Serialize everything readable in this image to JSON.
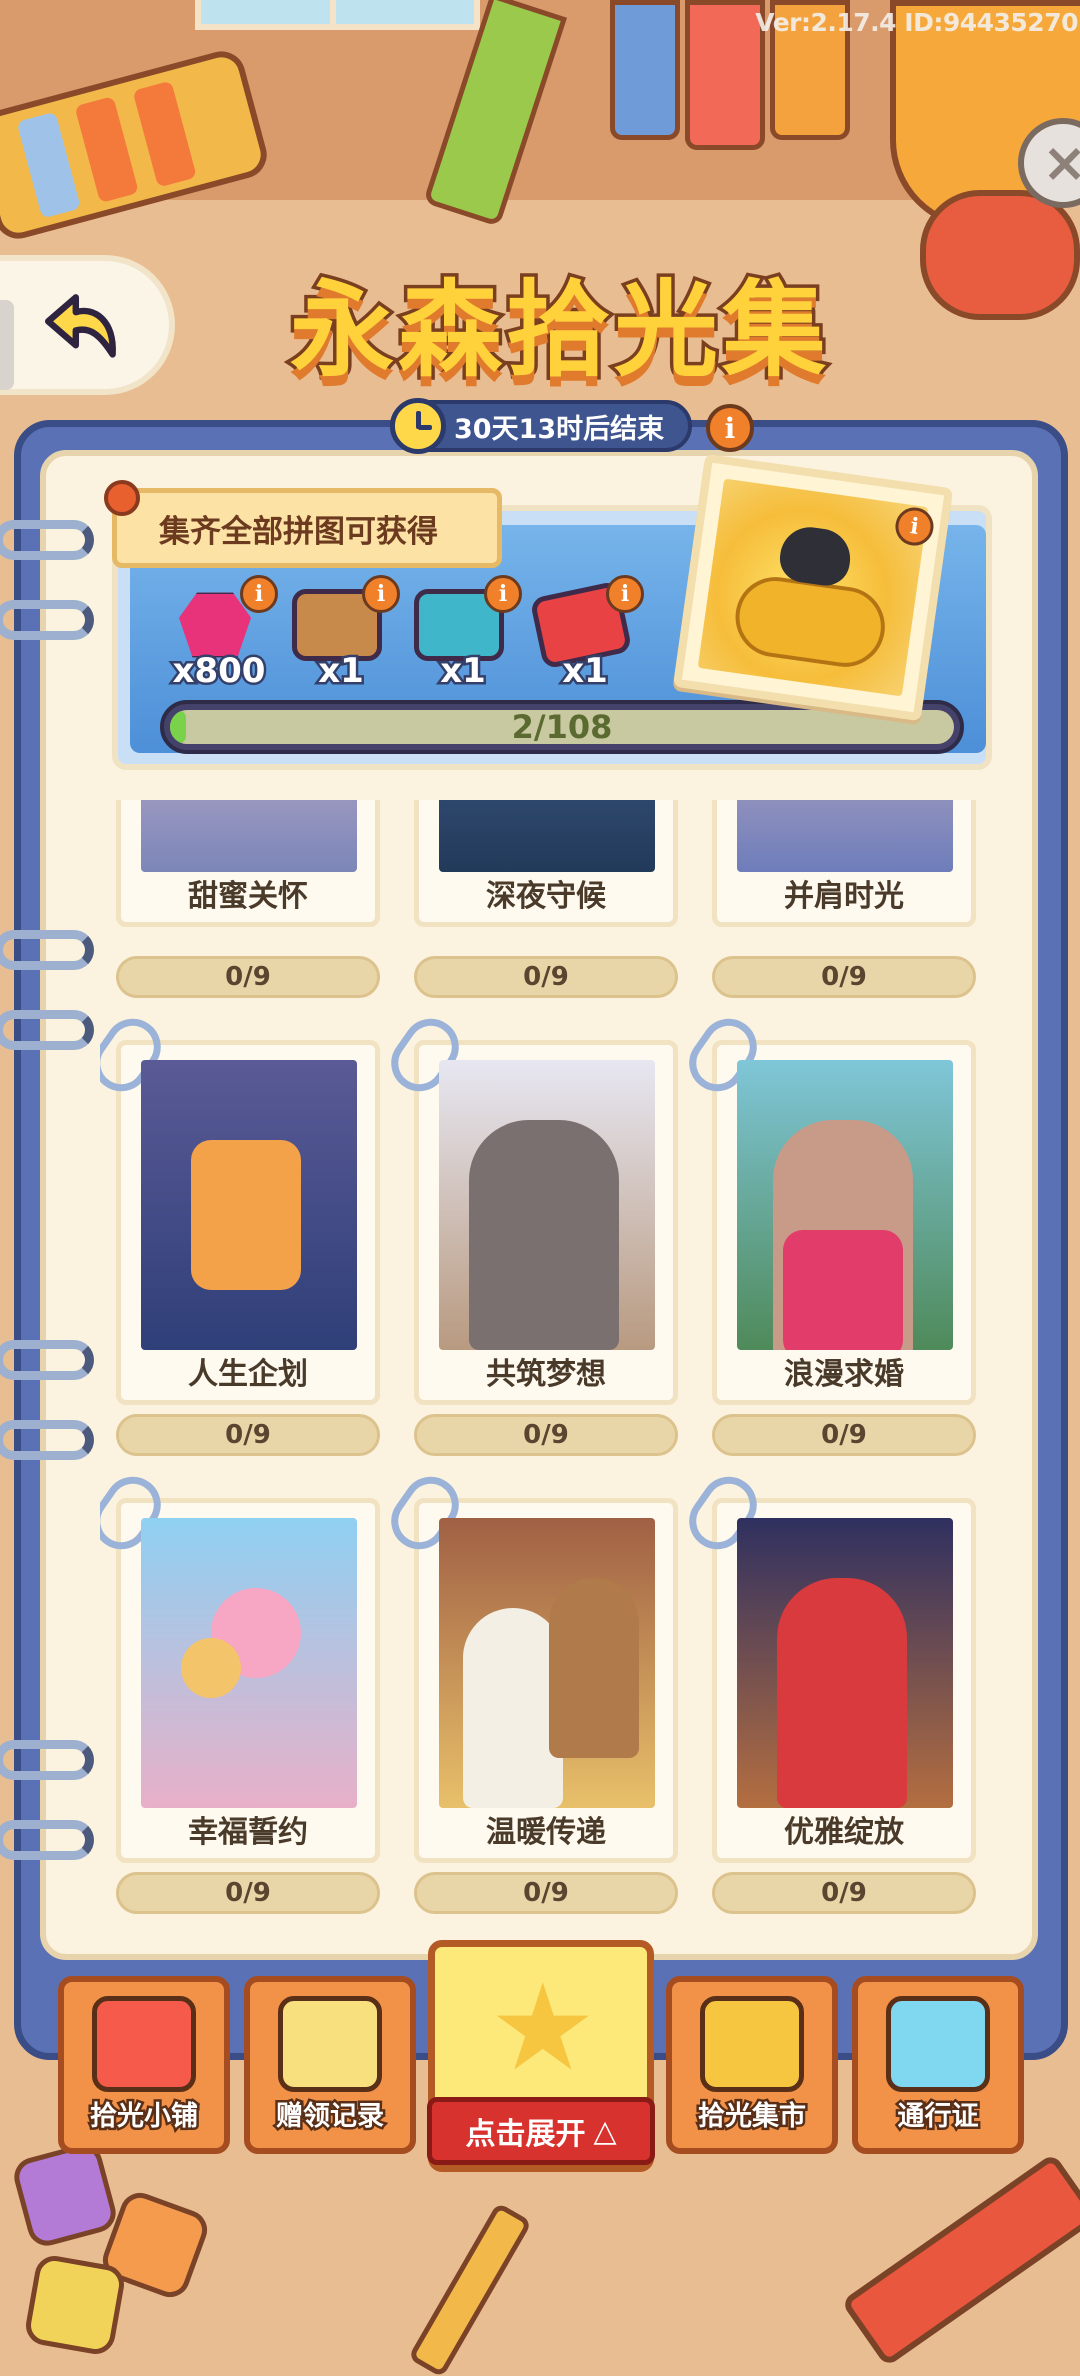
{
  "header": {
    "version": "Ver:2.17.4 ID:94435270",
    "title": "永森拾光集",
    "timer": "30天13时后结束"
  },
  "reward_panel": {
    "ribbon": "集齐全部拼图可获得",
    "items": [
      {
        "icon": "gem-icon",
        "qty": "x800"
      },
      {
        "icon": "crate-icon",
        "qty": "x1"
      },
      {
        "icon": "chest-icon",
        "qty": "x1"
      },
      {
        "icon": "ticket-icon",
        "qty": "x1"
      }
    ],
    "progress_text": "2/108",
    "progress_fraction": 0.0185
  },
  "albums": [
    {
      "name": "甜蜜关怀",
      "count": "0/9",
      "art": "art-sweet"
    },
    {
      "name": "深夜守候",
      "count": "0/9",
      "art": "art-night"
    },
    {
      "name": "并肩时光",
      "count": "0/9",
      "art": "art-shoulder"
    },
    {
      "name": "人生企划",
      "count": "0/9",
      "art": "art-life"
    },
    {
      "name": "共筑梦想",
      "count": "0/9",
      "art": "art-build"
    },
    {
      "name": "浪漫求婚",
      "count": "0/9",
      "art": "art-romance"
    },
    {
      "name": "幸福誓约",
      "count": "0/9",
      "art": "art-promise"
    },
    {
      "name": "温暖传递",
      "count": "0/9",
      "art": "art-warm"
    },
    {
      "name": "优雅绽放",
      "count": "0/9",
      "art": "art-elegant"
    }
  ],
  "bottom_nav": {
    "shop": "拾光小铺",
    "gift_log": "赠领记录",
    "expand": "点击展开",
    "market": "拾光集市",
    "pass": "通行证"
  },
  "colors": {
    "accent": "#f19248",
    "notebook": "#5a72b5",
    "page": "#fbf3df",
    "title": "#ffd23c"
  }
}
